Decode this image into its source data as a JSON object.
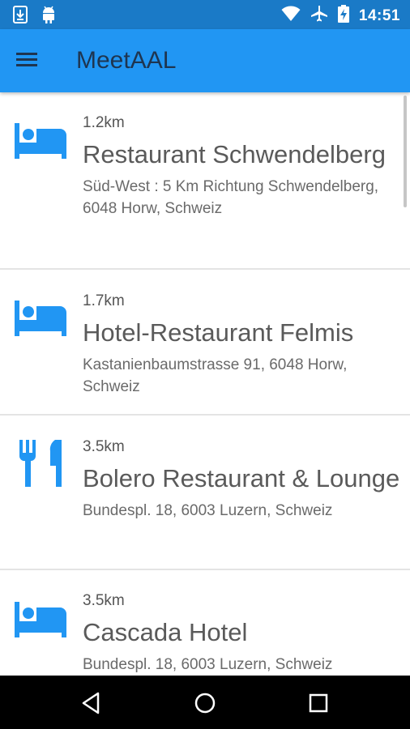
{
  "status_bar": {
    "time": "14:51",
    "icons": [
      "download-icon",
      "android-icon",
      "wifi-icon",
      "airplane-mode-icon",
      "battery-charging-icon"
    ]
  },
  "app_bar": {
    "title": "MeetAAL",
    "menu_icon": "hamburger-menu-icon"
  },
  "colors": {
    "status_bar": "#1a7ac7",
    "app_bar": "#2196f3",
    "accent_icon": "#2196f3",
    "title_text": "#1e3550",
    "nav_bar": "#000000"
  },
  "places": [
    {
      "distance": "1.2km",
      "name": "Restaurant Schwendelberg",
      "address": "Süd-West : 5 Km Richtung Schwendelberg, 6048 Horw, Schweiz",
      "icon": "hotel-bed-icon"
    },
    {
      "distance": "1.7km",
      "name": "Hotel-Restaurant Felmis",
      "address": "Kastanienbaumstrasse 91, 6048 Horw, Schweiz",
      "icon": "hotel-bed-icon"
    },
    {
      "distance": "3.5km",
      "name": "Bolero Restaurant & Lounge",
      "address": "Bundespl. 18, 6003 Luzern, Schweiz",
      "icon": "restaurant-fork-knife-icon"
    },
    {
      "distance": "3.5km",
      "name": "Cascada Hotel",
      "address": "Bundespl. 18, 6003 Luzern, Schweiz",
      "icon": "hotel-bed-icon"
    }
  ],
  "nav_bar": {
    "buttons": [
      "back-icon",
      "home-icon",
      "recents-icon"
    ]
  }
}
